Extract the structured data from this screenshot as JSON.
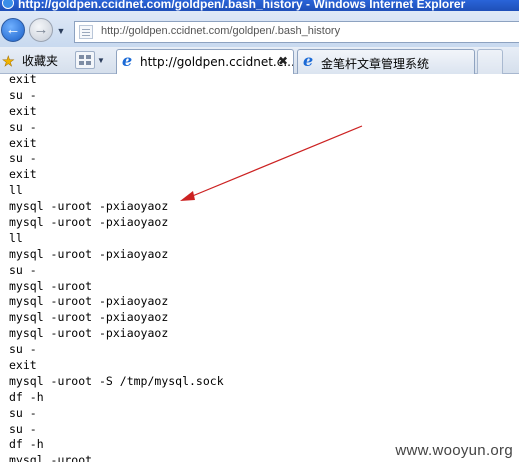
{
  "window": {
    "title": "http://goldpen.ccidnet.com/goldpen/.bash_history - Windows Internet Explorer"
  },
  "address_bar": {
    "url": "http://goldpen.ccidnet.com/goldpen/.bash_history"
  },
  "icons": {
    "back": "back-arrow-icon",
    "forward": "forward-arrow-icon",
    "favorites": "star-icon",
    "quick_tabs": "grid-icon",
    "tab_favicon": "ie-icon",
    "page": "page-icon"
  },
  "toolbar": {
    "favorites_label": "收藏夹"
  },
  "tabs": [
    {
      "title": "http://goldpen.ccidnet.c...",
      "active": true,
      "close": "✖"
    },
    {
      "title": "金笔杆文章管理系统",
      "active": false
    }
  ],
  "content": {
    "lines": [
      "exit",
      "su -",
      "exit",
      "su -",
      "exit",
      "su -",
      "exit",
      "ll",
      "mysql -uroot -pxiaoyaoz",
      "mysql -uroot -pxiaoyaoz",
      "ll",
      "mysql -uroot -pxiaoyaoz",
      "su -",
      "mysql -uroot",
      "mysql -uroot -pxiaoyaoz",
      "mysql -uroot -pxiaoyaoz",
      "mysql -uroot -pxiaoyaoz",
      "su -",
      "exit",
      "mysql -uroot -S /tmp/mysql.sock",
      "df -h",
      "su -",
      "su -",
      "df -h",
      "mysql -uroot"
    ]
  },
  "annotation": {
    "arrow_color": "#cc2222"
  },
  "watermark": "www.wooyun.org"
}
